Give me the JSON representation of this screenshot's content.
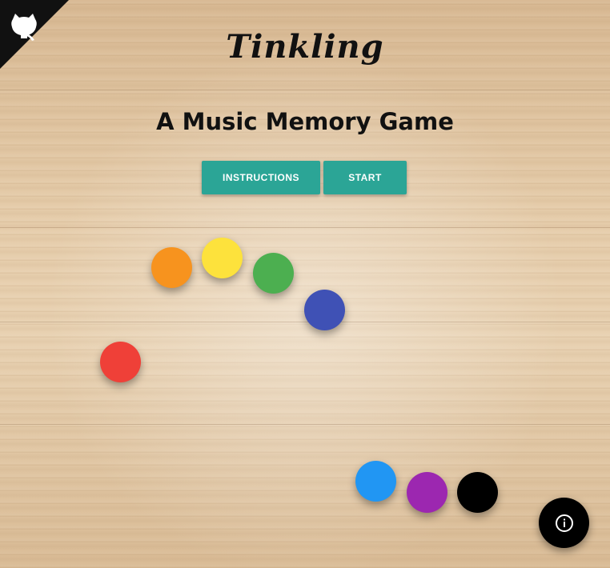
{
  "header": {
    "title": "Tinkling",
    "subtitle": "A Music Memory Game"
  },
  "buttons": {
    "instructions_label": "INSTRUCTIONS",
    "start_label": "START"
  },
  "colors": {
    "button": "#2ba596",
    "corner": "#111111",
    "info_button": "#000000"
  },
  "notes": [
    {
      "name": "red",
      "color": "#ef4038"
    },
    {
      "name": "orange",
      "color": "#f7931e"
    },
    {
      "name": "yellow",
      "color": "#fde23c"
    },
    {
      "name": "green",
      "color": "#4caf50"
    },
    {
      "name": "indigo",
      "color": "#3f51b5"
    },
    {
      "name": "blue",
      "color": "#2196f3"
    },
    {
      "name": "purple",
      "color": "#9c27b0"
    },
    {
      "name": "black",
      "color": "#000000"
    }
  ],
  "icons": {
    "corner": "github-cat-icon",
    "info": "info-icon"
  }
}
